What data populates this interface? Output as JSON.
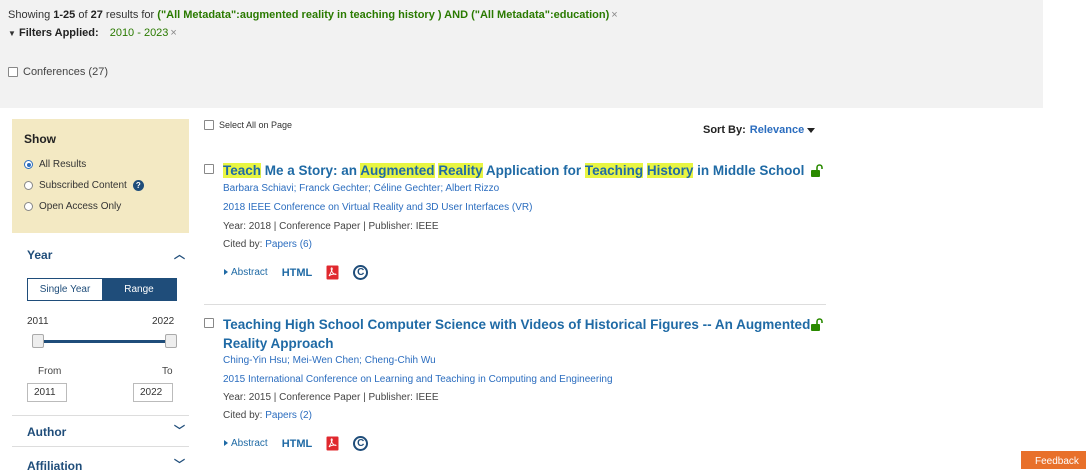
{
  "summary": {
    "prefix": "Showing",
    "range": "1-25",
    "of": "of",
    "total": "27",
    "results_for": "results for",
    "query": "(\"All Metadata\":augmented reality in teaching history ) AND (\"All Metadata\":education)"
  },
  "filters": {
    "label": "Filters Applied:",
    "value": "2010 - 2023",
    "remove": "×"
  },
  "content_type": {
    "conferences": "Conferences (27)"
  },
  "show": {
    "title": "Show",
    "options": [
      "All Results",
      "Subscribed Content",
      "Open Access Only"
    ],
    "selected": 0
  },
  "year": {
    "title": "Year",
    "single_year": "Single Year",
    "range": "Range",
    "slider_min": "2011",
    "slider_max": "2022",
    "from_label": "From",
    "to_label": "To",
    "from_value": "2011",
    "to_value": "2022"
  },
  "sidebar_sections": {
    "author": "Author",
    "affiliation": "Affiliation"
  },
  "select_all": "Select All on Page",
  "sort": {
    "label": "Sort By:",
    "value": "Relevance"
  },
  "results": [
    {
      "title_parts": [
        {
          "t": "Teach",
          "hl": true
        },
        {
          "t": " Me a Story: an ",
          "hl": false
        },
        {
          "t": "Augmented",
          "hl": true
        },
        {
          "t": " ",
          "hl": false
        },
        {
          "t": "Reality",
          "hl": true
        },
        {
          "t": " Application for ",
          "hl": false
        },
        {
          "t": "Teaching",
          "hl": true
        },
        {
          "t": " ",
          "hl": false
        },
        {
          "t": "History",
          "hl": true
        },
        {
          "t": " in Middle School",
          "hl": false
        }
      ],
      "authors": "Barbara Schiavi; Franck Gechter; Céline Gechter; Albert Rizzo",
      "venue": "2018 IEEE Conference on Virtual Reality and 3D User Interfaces (VR)",
      "meta": "Year: 2018  |  Conference Paper  |  Publisher: IEEE",
      "cited_prefix": "Cited by: ",
      "cited": "Papers (6)",
      "abstract": "Abstract",
      "html": "HTML"
    },
    {
      "title_parts": [
        {
          "t": "Teaching High School Computer Science with Videos of Historical Figures -- An Augmented Reality Approach",
          "hl": false
        }
      ],
      "authors": "Ching-Yin Hsu; Mei-Wen Chen; Cheng-Chih Wu",
      "venue": "2015 International Conference on Learning and Teaching in Computing and Engineering",
      "meta": "Year: 2015  |  Conference Paper  |  Publisher: IEEE",
      "cited_prefix": "Cited by: ",
      "cited": "Papers (2)",
      "abstract": "Abstract",
      "html": "HTML"
    }
  ],
  "feedback": "Feedback",
  "colors": {
    "banner": "#f2f2f2",
    "show_panel": "#f3e9c3",
    "link": "#1f6aa5",
    "query_green": "#2a7a00",
    "highlight": "#e8f542",
    "pdf_red": "#e0282e",
    "open_access_green": "#2a8a00",
    "feedback": "#e8702a"
  },
  "icons": {
    "open_access": "unlock-icon",
    "pdf": "pdf-icon",
    "copyright": "copyright-icon",
    "help": "help-icon"
  }
}
